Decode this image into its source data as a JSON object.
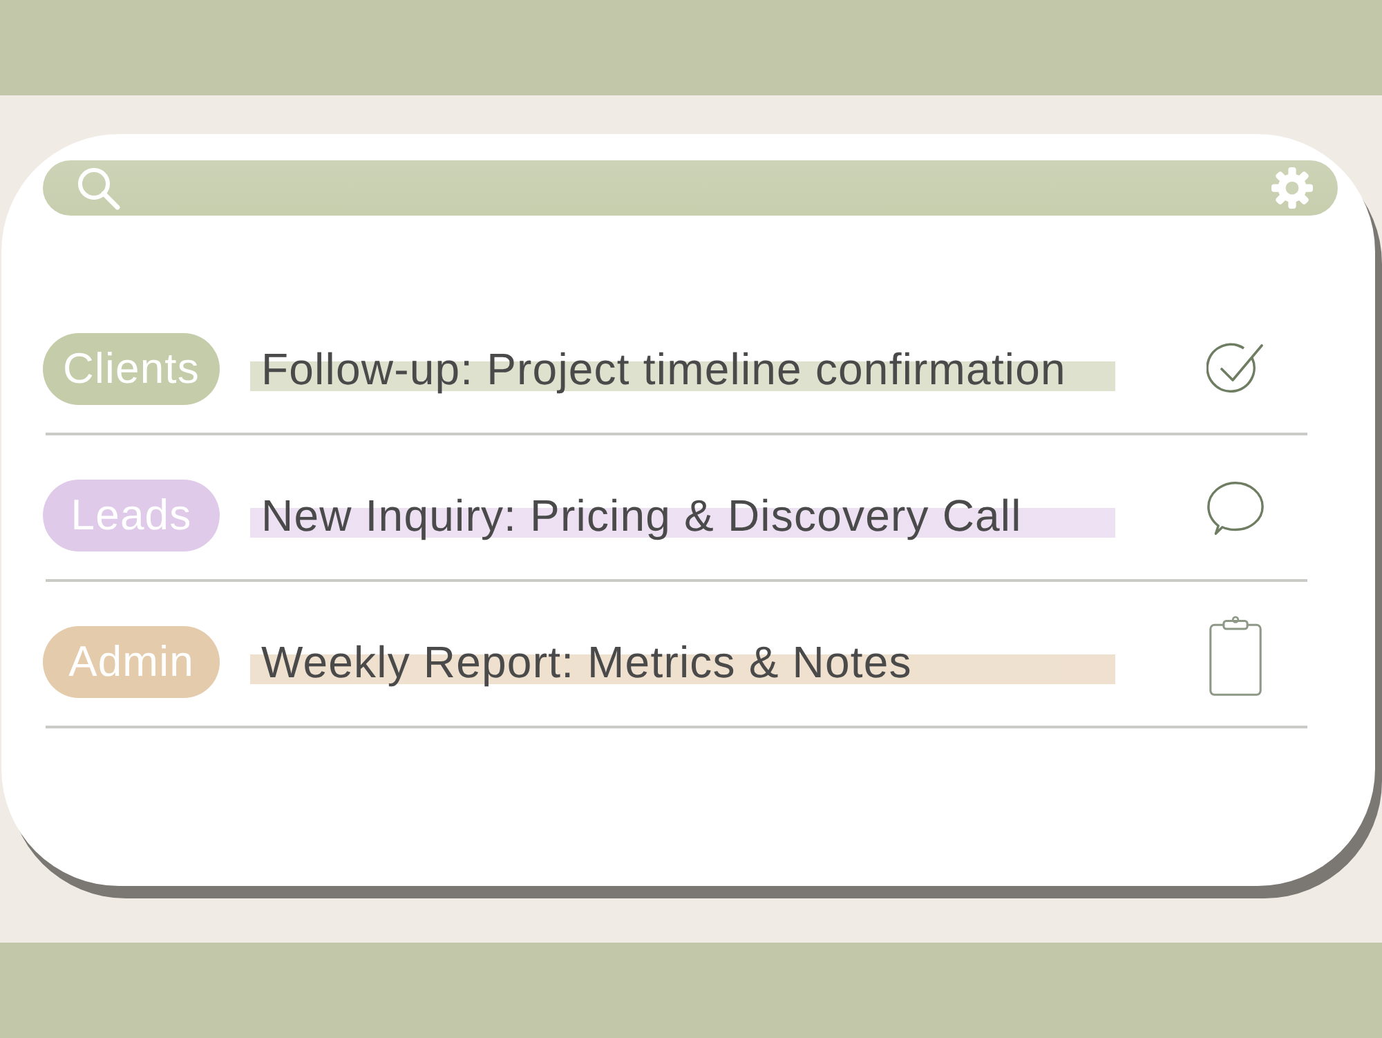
{
  "messages": [
    {
      "tag": "Clients",
      "color": "#c5cca9",
      "title": "Follow-up: Project timeline confirmation",
      "kind": "check"
    },
    {
      "tag": "Leads",
      "color": "#dfcbe9",
      "title": "New Inquiry: Pricing & Discovery Call",
      "kind": "chat"
    },
    {
      "tag": "Admin",
      "color": "#e4cbac",
      "title": "Weekly Report: Metrics & Notes",
      "kind": "clipboard"
    }
  ]
}
